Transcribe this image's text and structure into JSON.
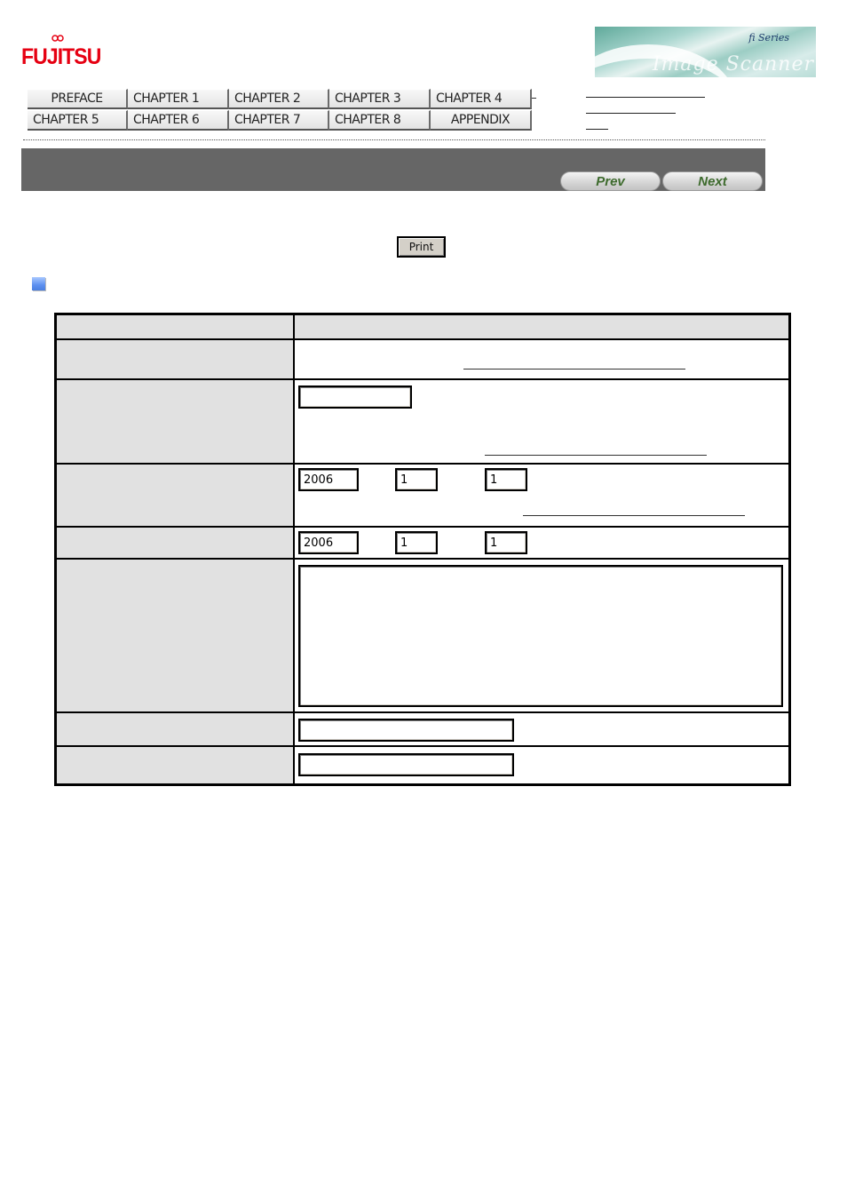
{
  "brand": {
    "logo_text": "FUJITSU",
    "banner_series": "fi Series",
    "banner_subtitle": "Image Scanner"
  },
  "chapter_nav": {
    "items": [
      {
        "label": "PREFACE"
      },
      {
        "label": "CHAPTER 1"
      },
      {
        "label": "CHAPTER 2"
      },
      {
        "label": "CHAPTER 3"
      },
      {
        "label": "CHAPTER 4"
      },
      {
        "label": "CHAPTER 5"
      },
      {
        "label": "CHAPTER 6"
      },
      {
        "label": "CHAPTER 7"
      },
      {
        "label": "CHAPTER 8"
      },
      {
        "label": "APPENDIX"
      }
    ]
  },
  "title_bar": {
    "prev_label": "Prev",
    "next_label": "Next"
  },
  "toolbar": {
    "print_label": "Print"
  },
  "form": {
    "row_start": {
      "year": "2006",
      "month": "1",
      "day": "1"
    },
    "row_end": {
      "year": "2006",
      "month": "1",
      "day": "1"
    },
    "text_field_1": "",
    "textarea": "",
    "text_field_2": "",
    "text_field_3": ""
  }
}
